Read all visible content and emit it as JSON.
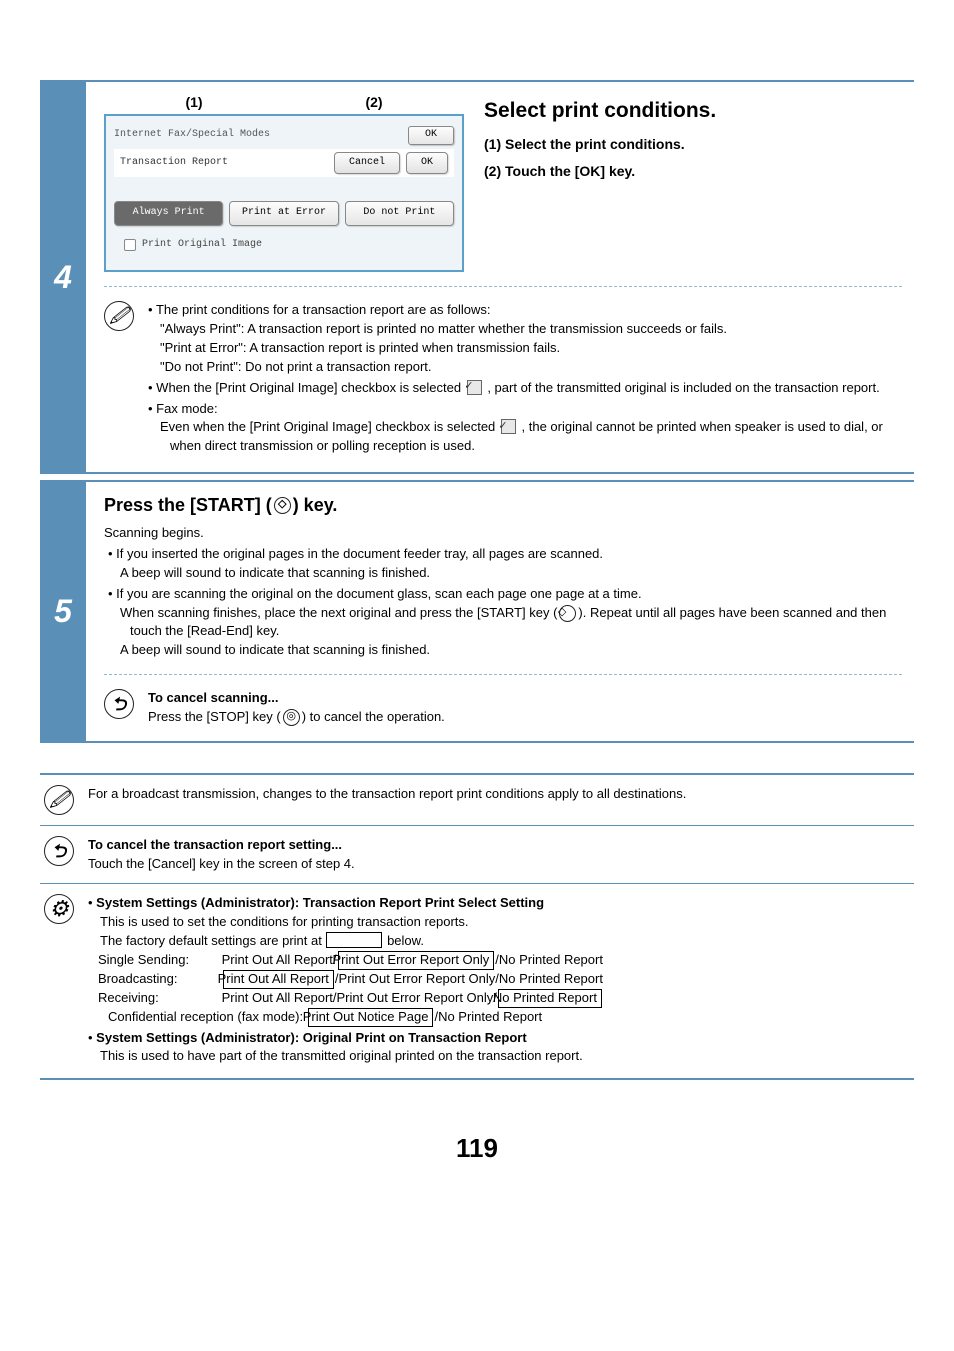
{
  "step4": {
    "callout1": "(1)",
    "callout2": "(2)",
    "panel_title": "Internet Fax/Special Modes",
    "panel_ok": "OK",
    "sub_title": "Transaction Report",
    "btn_cancel": "Cancel",
    "btn_ok": "OK",
    "opt_always": "Always Print",
    "opt_error": "Print at Error",
    "opt_donot": "Do not Print",
    "chk_label": "Print Original Image",
    "heading": "Select print conditions.",
    "sub1": "(1)  Select the print conditions.",
    "sub2": "(2)  Touch the [OK] key.",
    "notes": {
      "n1": "The print conditions for a transaction report are as follows:",
      "n1a": "\"Always Print\":  A transaction report is printed no matter whether the transmission succeeds or fails.",
      "n1b": "\"Print at Error\": A transaction report is printed when transmission fails.",
      "n1c": "\"Do not Print\":   Do not print a transaction report.",
      "n2a": "When the [Print Original Image] checkbox is selected ",
      "n2b": " , part of the transmitted original is included on the transaction report.",
      "n3": "Fax mode:",
      "n3a": "Even when the [Print Original Image] checkbox is selected ",
      "n3b": " , the original cannot be printed when speaker is used to dial, or when direct transmission or polling reception is used."
    }
  },
  "step5": {
    "heading_pre": "Press the [START] (",
    "heading_post": ") key.",
    "p1": "Scanning begins.",
    "b1": "If you inserted the original pages in the document feeder tray, all pages are scanned.",
    "b1a": "A beep will sound to indicate that scanning is finished.",
    "b2": "If you are scanning the original on the document glass, scan each page one page at a time.",
    "b2a_pre": "When scanning finishes, place the next original and press the [START] key (",
    "b2a_post": "). Repeat until all pages have been scanned and then touch the [Read-End] key.",
    "b2b": "A beep will sound to indicate that scanning is finished.",
    "cancel_h": "To cancel scanning...",
    "cancel_pre": "Press the [STOP] key (",
    "cancel_post": ") to cancel the operation."
  },
  "info": {
    "row1": "For a broadcast transmission, changes to the transaction report print conditions apply to all destinations.",
    "row2_h": "To cancel the transaction report setting...",
    "row2_t": "Touch the [Cancel] key in the screen of step 4.",
    "row3_h1": "System Settings (Administrator): Transaction Report Print Select Setting",
    "row3_t1": "This is used to set the conditions for printing transaction reports.",
    "row3_t2_pre": "The factory default settings are print at ",
    "row3_t2_post": " below.",
    "ss_label": "Single Sending:",
    "ss_a": "Print Out All Report/",
    "ss_box": "Print Out Error Report Only",
    "ss_c": "/No Printed Report",
    "bc_label": "Broadcasting:",
    "bc_box": "Print Out All Report",
    "bc_c": "/Print Out Error Report Only/No Printed Report",
    "rc_label": "Receiving:",
    "rc_a": "Print Out All Report/Print Out Error Report Only/",
    "rc_box": "No Printed Report",
    "cr_label_pre": "Confidential reception (fax mode): ",
    "cr_box": "Print Out Notice Page",
    "cr_c": "/No Printed Report",
    "row3_h2": "System Settings (Administrator): Original Print on Transaction Report",
    "row3_t3": "This is used to have part of the transmitted original printed on the transaction report."
  },
  "page_number": "119"
}
